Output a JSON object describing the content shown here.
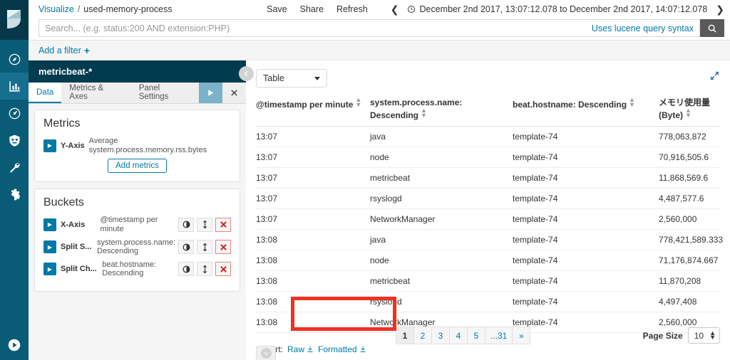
{
  "rail": {
    "logo_icon": "kibana-logo",
    "items": [
      {
        "name": "discover",
        "icon": "compass-icon",
        "active": false
      },
      {
        "name": "visualize",
        "icon": "bar-chart-icon",
        "active": true
      },
      {
        "name": "timelion",
        "icon": "clock-icon",
        "active": false
      },
      {
        "name": "monitoring",
        "icon": "shield-icon",
        "active": false
      },
      {
        "name": "dev-tools",
        "icon": "wrench-icon",
        "active": false
      },
      {
        "name": "management",
        "icon": "gear-icon",
        "active": false
      }
    ],
    "collapse_icon": "play-circle-icon"
  },
  "topnav": {
    "breadcrumb_root": "Visualize",
    "breadcrumb_sep": "/",
    "breadcrumb_current": "used-memory-process",
    "actions": [
      "Save",
      "Share",
      "Refresh"
    ],
    "time_prev_icon": "chevron-left-icon",
    "time_next_icon": "chevron-right-icon",
    "time_clock_icon": "clock-icon",
    "time_range": "December 2nd 2017, 13:07:12.078 to December 2nd 2017, 14:07:12.078"
  },
  "search": {
    "value": "",
    "placeholder": "Search... (e.g. status:200 AND extension:PHP)",
    "hint": "Uses lucene query syntax",
    "button_icon": "search-icon"
  },
  "filterbar": {
    "add_filter": "Add a filter",
    "plus": "+"
  },
  "editor": {
    "index_title": "metricbeat-*",
    "tabs": [
      {
        "label": "Data",
        "active": true
      },
      {
        "label": "Metrics & Axes",
        "active": false
      },
      {
        "label": "Panel Settings",
        "active": false
      }
    ],
    "apply_icon": "play-icon",
    "close_icon": "close-icon",
    "collapse_icon": "chevron-left-circle-icon",
    "metrics": {
      "title": "Metrics",
      "rows": [
        {
          "label": "Y-Axis",
          "desc": "Average system.process.memory.rss.bytes"
        }
      ],
      "add_button": "Add metrics"
    },
    "buckets": {
      "title": "Buckets",
      "rows": [
        {
          "label": "X-Axis",
          "desc": "@timestamp per minute"
        },
        {
          "label": "Split S...",
          "desc": "system.process.name: Descending"
        },
        {
          "label": "Split Ch...",
          "desc": "beat.hostname: Descending"
        }
      ],
      "toggle_icon": "toggle-icon",
      "move_icon": "move-updown-icon",
      "remove_icon": "remove-x-icon"
    }
  },
  "vis": {
    "type_select": "Table",
    "expand_icon": "expand-arrows-icon",
    "spy_toggle_icon": "chevron-down-circle-icon",
    "table": {
      "columns": [
        "@timestamp per minute",
        "system.process.name: Descending",
        "beat.hostname: Descending",
        "メモリ使用量 (Byte)"
      ],
      "rows": [
        [
          "13:07",
          "java",
          "template-74",
          "778,063,872"
        ],
        [
          "13:07",
          "node",
          "template-74",
          "70,916,505.6"
        ],
        [
          "13:07",
          "metricbeat",
          "template-74",
          "11,868,569.6"
        ],
        [
          "13:07",
          "rsyslogd",
          "template-74",
          "4,487,577.6"
        ],
        [
          "13:07",
          "NetworkManager",
          "template-74",
          "2,560,000"
        ],
        [
          "13:08",
          "java",
          "template-74",
          "778,421,589.333"
        ],
        [
          "13:08",
          "node",
          "template-74",
          "71,176,874.667"
        ],
        [
          "13:08",
          "metricbeat",
          "template-74",
          "11,870,208"
        ],
        [
          "13:08",
          "rsyslogd",
          "template-74",
          "4,497,408"
        ],
        [
          "13:08",
          "NetworkManager",
          "template-74",
          "2,560,000"
        ]
      ]
    },
    "export": {
      "label": "Export:",
      "raw": "Raw",
      "formatted": "Formatted",
      "download_icon": "download-icon",
      "highlight_color": "#f03022"
    },
    "pager": {
      "pages": [
        "1",
        "2",
        "3",
        "4",
        "5",
        "...31",
        "»"
      ],
      "active_index": 0,
      "page_size_label": "Page Size",
      "page_size_value": "10"
    }
  },
  "colors": {
    "rail_bg": "#0a5c76",
    "rail_logo_bg": "#07384a",
    "editor_head_bg": "#013b4f",
    "accent_link": "#0079a5",
    "apply_btn": "#7ab3c7"
  }
}
